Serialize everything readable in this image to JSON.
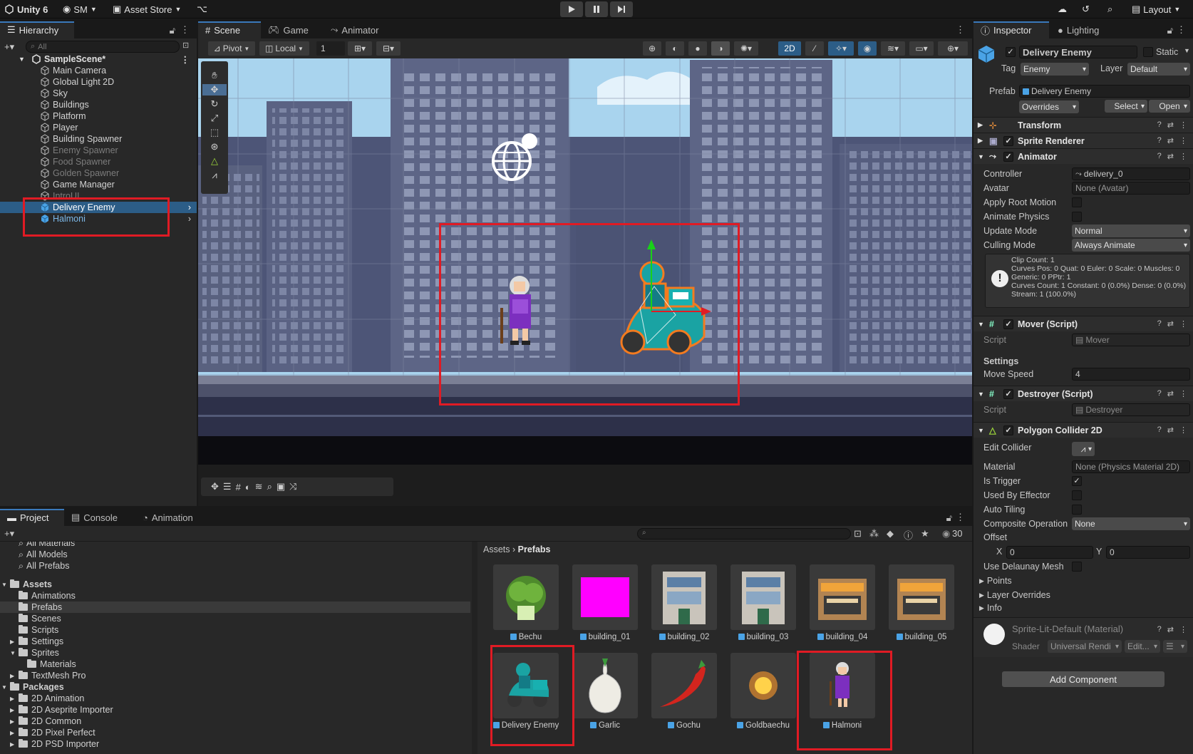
{
  "topbar": {
    "app": "Unity 6",
    "account": "SM",
    "asset_store": "Asset Store",
    "layout": "Layout"
  },
  "hierarchy": {
    "tab": "Hierarchy",
    "search_placeholder": "All",
    "scene": "SampleScene*",
    "items": [
      {
        "label": "Main Camera",
        "state": "normal"
      },
      {
        "label": "Global Light 2D",
        "state": "normal"
      },
      {
        "label": "Sky",
        "state": "normal"
      },
      {
        "label": "Buildings",
        "state": "normal"
      },
      {
        "label": "Platform",
        "state": "normal"
      },
      {
        "label": "Player",
        "state": "normal"
      },
      {
        "label": "Building Spawner",
        "state": "normal"
      },
      {
        "label": "Enemy Spawner",
        "state": "dim"
      },
      {
        "label": "Food Spawner",
        "state": "dim"
      },
      {
        "label": "Golden Spawner",
        "state": "dim"
      },
      {
        "label": "Game Manager",
        "state": "normal"
      },
      {
        "label": "IntroUI",
        "state": "dim"
      },
      {
        "label": "Delivery Enemy",
        "state": "selected"
      },
      {
        "label": "Halmoni",
        "state": "prefab"
      }
    ]
  },
  "scene_tabs": {
    "scene": "Scene",
    "game": "Game",
    "animator": "Animator"
  },
  "scene_toolbar": {
    "pivot": "Pivot",
    "local": "Local",
    "grid_size": "1",
    "mode_2d": "2D"
  },
  "inspector": {
    "tab": "Inspector",
    "lighting_tab": "Lighting",
    "object_name": "Delivery Enemy",
    "static_label": "Static",
    "tag_label": "Tag",
    "tag_value": "Enemy",
    "layer_label": "Layer",
    "layer_value": "Default",
    "prefab_label": "Prefab",
    "prefab_value": "Delivery Enemy",
    "overrides": "Overrides",
    "select": "Select",
    "open": "Open",
    "transform": "Transform",
    "sprite_renderer": "Sprite Renderer",
    "animator": {
      "title": "Animator",
      "controller_label": "Controller",
      "controller_value": "delivery_0",
      "avatar_label": "Avatar",
      "avatar_value": "None (Avatar)",
      "apply_root_motion": "Apply Root Motion",
      "animate_physics": "Animate Physics",
      "update_mode_label": "Update Mode",
      "update_mode_value": "Normal",
      "culling_mode_label": "Culling Mode",
      "culling_mode_value": "Always Animate",
      "info_lines": [
        "Clip Count: 1",
        "Curves Pos: 0 Quat: 0 Euler: 0 Scale: 0 Muscles: 0",
        "Generic: 0 PPtr: 1",
        "Curves Count: 1 Constant: 0 (0.0%) Dense: 0 (0.0%)",
        "Stream: 1 (100.0%)"
      ]
    },
    "mover": {
      "title": "Mover (Script)",
      "script_label": "Script",
      "script_value": "Mover",
      "settings": "Settings",
      "move_speed_label": "Move Speed",
      "move_speed_value": "4"
    },
    "destroyer": {
      "title": "Destroyer (Script)",
      "script_label": "Script",
      "script_value": "Destroyer"
    },
    "polygon": {
      "title": "Polygon Collider 2D",
      "edit_collider": "Edit Collider",
      "material_label": "Material",
      "material_value": "None (Physics Material 2D)",
      "is_trigger": "Is Trigger",
      "used_by_effector": "Used By Effector",
      "auto_tiling": "Auto Tiling",
      "composite_label": "Composite Operation",
      "composite_value": "None",
      "offset": "Offset",
      "x_label": "X",
      "x_value": "0",
      "y_label": "Y",
      "y_value": "0",
      "delaunay": "Use Delaunay Mesh",
      "points": "Points",
      "layer_overrides": "Layer Overrides",
      "info": "Info"
    },
    "material": {
      "name": "Sprite-Lit-Default (Material)",
      "shader_label": "Shader",
      "shader_value": "Universal Rendi",
      "edit": "Edit..."
    },
    "add_component": "Add Component"
  },
  "project": {
    "tabs": {
      "project": "Project",
      "console": "Console",
      "animation": "Animation"
    },
    "count": "30",
    "breadcrumb_root": "Assets",
    "breadcrumb_current": "Prefabs",
    "favorites": [
      "All Materials",
      "All Models",
      "All Prefabs"
    ],
    "tree": [
      {
        "label": "Assets",
        "level": 0,
        "bold": true
      },
      {
        "label": "Animations",
        "level": 1
      },
      {
        "label": "Prefabs",
        "level": 1,
        "selected": true
      },
      {
        "label": "Scenes",
        "level": 1
      },
      {
        "label": "Scripts",
        "level": 1
      },
      {
        "label": "Settings",
        "level": 1
      },
      {
        "label": "Sprites",
        "level": 1
      },
      {
        "label": "Materials",
        "level": 2
      },
      {
        "label": "TextMesh Pro",
        "level": 1
      },
      {
        "label": "Packages",
        "level": 0,
        "bold": true
      },
      {
        "label": "2D Animation",
        "level": 1
      },
      {
        "label": "2D Aseprite Importer",
        "level": 1
      },
      {
        "label": "2D Common",
        "level": 1
      },
      {
        "label": "2D Pixel Perfect",
        "level": 1
      },
      {
        "label": "2D PSD Importer",
        "level": 1
      }
    ],
    "assets": [
      {
        "label": "Bechu",
        "icon": "cabbage-icon"
      },
      {
        "label": "building_01",
        "icon": "magenta-square-icon"
      },
      {
        "label": "building_02",
        "icon": "building-icon"
      },
      {
        "label": "building_03",
        "icon": "building-icon"
      },
      {
        "label": "building_04",
        "icon": "shop-icon"
      },
      {
        "label": "building_05",
        "icon": "shop-icon"
      },
      {
        "label": "Delivery Enemy",
        "icon": "scooter-icon"
      },
      {
        "label": "Garlic",
        "icon": "garlic-icon"
      },
      {
        "label": "Gochu",
        "icon": "pepper-icon"
      },
      {
        "label": "Goldbaechu",
        "icon": "gold-glow-icon"
      },
      {
        "label": "Halmoni",
        "icon": "grandma-icon"
      }
    ]
  }
}
